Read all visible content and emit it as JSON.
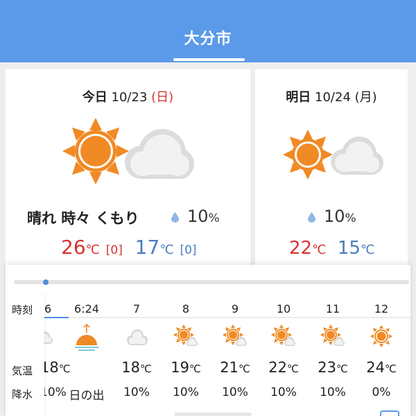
{
  "header": {
    "title": "大分市"
  },
  "today": {
    "date_label": "今日",
    "date": "10/23",
    "weekday": "(日)",
    "forecast": "晴れ 時々 くもり",
    "pop": "10",
    "pop_unit": "%",
    "high": "26",
    "high_diff": "[0]",
    "low": "17",
    "low_diff": "[0]",
    "unit": "℃",
    "icon": "sun-cloud-icon"
  },
  "tomorrow": {
    "date_label": "明日",
    "date": "10/24",
    "weekday": "(月)",
    "pop": "10",
    "pop_unit": "%",
    "high": "22",
    "low": "15",
    "unit": "℃",
    "icon": "sun-cloud-icon"
  },
  "hourly": {
    "labels": {
      "time": "時刻",
      "temp": "気温",
      "rain": "降水"
    },
    "columns": [
      {
        "time": "6",
        "icon": "cloud-icon",
        "temp": "18",
        "temp_unit": "℃",
        "rain": "10%"
      },
      {
        "time": "6:24",
        "icon": "sunrise-icon",
        "temp": "",
        "temp_unit": "",
        "rain": "日の出"
      },
      {
        "time": "7",
        "icon": "cloud-icon",
        "temp": "18",
        "temp_unit": "℃",
        "rain": "10%"
      },
      {
        "time": "8",
        "icon": "sun-cloud-icon",
        "temp": "19",
        "temp_unit": "℃",
        "rain": "10%"
      },
      {
        "time": "9",
        "icon": "sun-cloud-icon",
        "temp": "21",
        "temp_unit": "℃",
        "rain": "10%"
      },
      {
        "time": "10",
        "icon": "sun-cloud-icon",
        "temp": "22",
        "temp_unit": "℃",
        "rain": "10%"
      },
      {
        "time": "11",
        "icon": "sun-cloud-icon",
        "temp": "23",
        "temp_unit": "℃",
        "rain": "10%"
      },
      {
        "time": "12",
        "icon": "sun-icon",
        "temp": "24",
        "temp_unit": "℃",
        "rain": "0%"
      }
    ]
  },
  "colors": {
    "header": "#5b9ae8",
    "sun": "#f08a24",
    "high": "#d8322f",
    "low": "#4a7bc0"
  }
}
